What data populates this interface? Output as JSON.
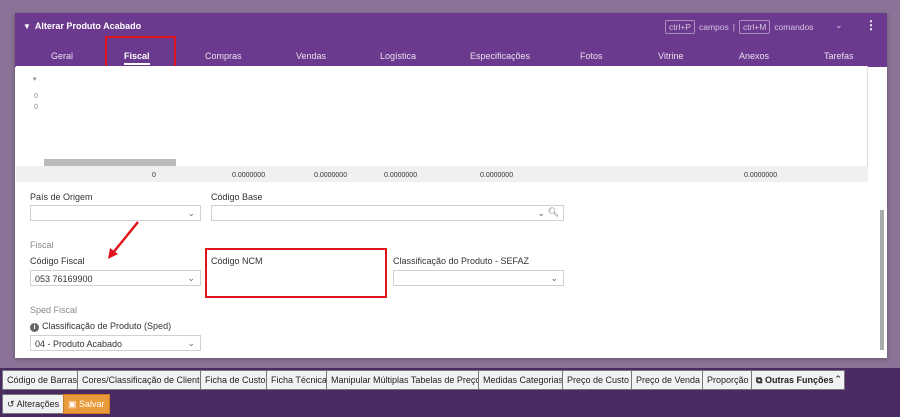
{
  "window": {
    "title": "Alterar Produto Acabado",
    "shortcut_1_key": "ctrl+P",
    "shortcut_1_label": "campos",
    "separator": "|",
    "shortcut_2_key": "ctrl+M",
    "shortcut_2_label": "comandos"
  },
  "tabs": [
    {
      "label": "Geral"
    },
    {
      "label": "Fiscal"
    },
    {
      "label": "Compras"
    },
    {
      "label": "Vendas"
    },
    {
      "label": "Logística"
    },
    {
      "label": "Especificações"
    },
    {
      "label": "Fotos"
    },
    {
      "label": "Vitrine"
    },
    {
      "label": "Anexos"
    },
    {
      "label": "Tarefas"
    }
  ],
  "grid": {
    "row_values": [
      "0",
      "0"
    ],
    "totals": [
      "0",
      "0.0000000",
      "0.0000000",
      "0.0000000",
      "0.0000000",
      "0.0000000"
    ]
  },
  "form": {
    "pais_origem": {
      "label": "País de Origem",
      "value": ""
    },
    "codigo_base": {
      "label": "Código Base",
      "value": ""
    },
    "fiscal_section": "Fiscal",
    "codigo_fiscal": {
      "label": "Código Fiscal",
      "value": "053 76169900"
    },
    "codigo_ncm": {
      "label": "Código NCM",
      "value": ""
    },
    "classificacao_sefaz": {
      "label": "Classificação do Produto - SEFAZ",
      "value": ""
    },
    "sped_section": "Sped Fiscal",
    "classificacao_sped": {
      "label": "Classificação de Produto (Sped)",
      "value": "04 - Produto Acabado"
    }
  },
  "toolbar": {
    "buttons": [
      "Código de Barras",
      "Cores/Classificação de Cliente",
      "Ficha de Custo",
      "Ficha Técnica",
      "Manipular Múltiplas Tabelas de Preço",
      "Medidas Categorias",
      "Preço de Custo",
      "Preço de Venda",
      "Proporção",
      "Outras Funções"
    ]
  },
  "actions": {
    "alteracoes": "Alterações",
    "salvar": "Salvar"
  },
  "colors": {
    "header": "#6b3a8e",
    "annotation": "#e0161e",
    "save": "#e89a3a"
  }
}
